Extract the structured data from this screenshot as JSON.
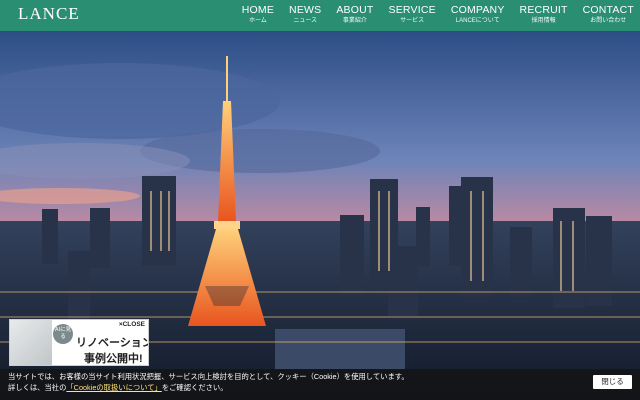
{
  "brand": {
    "logo_text": "LANCE",
    "header_color": "#2a8f72"
  },
  "nav": [
    {
      "en": "HOME",
      "jp": "ホーム"
    },
    {
      "en": "NEWS",
      "jp": "ニュース"
    },
    {
      "en": "ABOUT",
      "jp": "事業紹介"
    },
    {
      "en": "SERVICE",
      "jp": "サービス"
    },
    {
      "en": "COMPANY",
      "jp": "LANCEについて"
    },
    {
      "en": "RECRUIT",
      "jp": "採用情報"
    },
    {
      "en": "CONTACT",
      "jp": "お問い合わせ"
    }
  ],
  "promo": {
    "close_label": "×CLOSE",
    "badge_text": "AIに見る",
    "line1": "リノベーション",
    "line2": "事例公開中!"
  },
  "cookie": {
    "line1": "当サイトでは、お客様の当サイト利用状況把握、サービス向上検討を目的として、クッキー（Cookie）を使用しています。",
    "line2_prefix": "詳しくは、当社の",
    "line2_link": "「Cookieの取扱いについて」",
    "line2_suffix": "をご確認ください。",
    "close_label": "閉じる"
  }
}
